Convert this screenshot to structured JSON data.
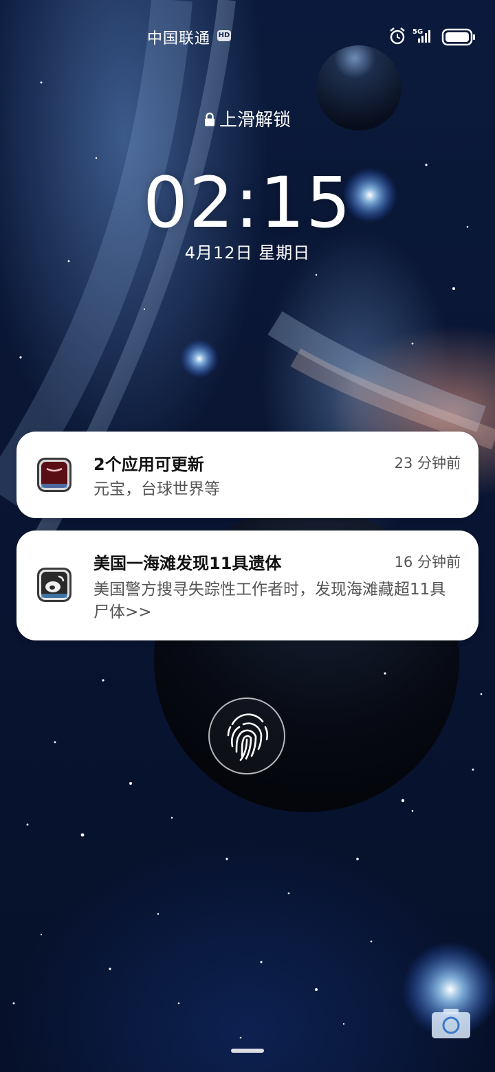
{
  "status_bar": {
    "carrier": "中国联通",
    "hd_badge": "HD",
    "network": "5G",
    "icons": [
      "alarm-icon",
      "signal-5g-icon",
      "battery-icon"
    ]
  },
  "lockscreen": {
    "unlock_hint": "上滑解锁",
    "time": "02:15",
    "date": "4月12日 星期日"
  },
  "notifications": [
    {
      "icon": "app-store-icon",
      "title": "2个应用可更新",
      "time": "23 分钟前",
      "body": "元宝，台球世界等"
    },
    {
      "icon": "weibo-icon",
      "title": "美国一海滩发现11具遗体",
      "time": "16 分钟前",
      "body": "美国警方搜寻失踪性工作者时，发现海滩藏超11具尸体>>"
    }
  ],
  "controls": {
    "fingerprint": "fingerprint-icon",
    "camera": "camera-icon"
  },
  "colors": {
    "notification_bg": "#ffffff",
    "title_text": "#111111",
    "secondary_text": "#555555"
  }
}
